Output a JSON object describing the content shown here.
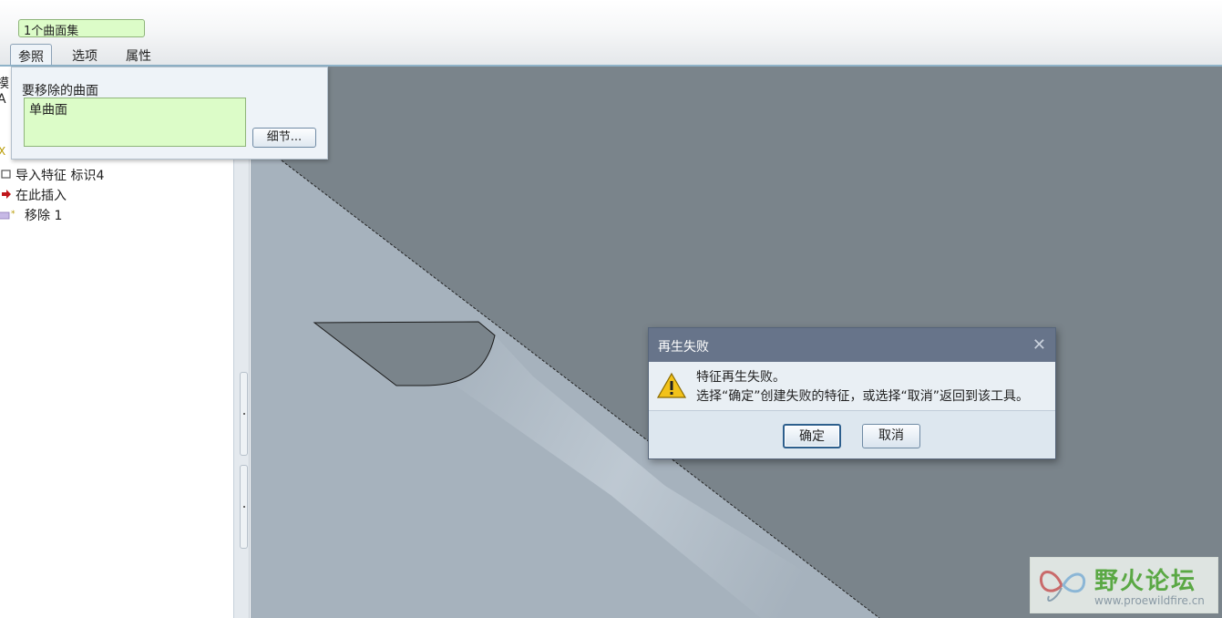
{
  "dashboard": {
    "collector_value": "1个曲面集",
    "tabs": [
      {
        "label": "参照",
        "active": true
      },
      {
        "label": "选项",
        "active": false
      },
      {
        "label": "属性",
        "active": false
      }
    ]
  },
  "ref_panel": {
    "label": "要移除的曲面",
    "selection": "单曲面",
    "detail_button": "细节..."
  },
  "model_tree": {
    "partial_items": [
      "模",
      "A",
      "X"
    ],
    "items": [
      {
        "label": "导入特征 标识4",
        "icon": "import-feature-icon"
      },
      {
        "label": "在此插入",
        "icon": "insert-here-arrow-icon"
      },
      {
        "label": "移除 1",
        "icon": "remove-feature-icon"
      }
    ]
  },
  "dialog": {
    "title": "再生失败",
    "message_line1": "特征再生失败。",
    "message_line2": "选择“确定”创建失败的特征，或选择“取消”返回到该工具。",
    "ok_label": "确定",
    "cancel_label": "取消",
    "icon": "warning-icon"
  },
  "watermark": {
    "title": "野火论坛",
    "url": "www.proewildfire.cn"
  },
  "colors": {
    "collector_bg": "#dcfcc8",
    "graphics_bg": "#7a848b",
    "dialog_title_bg": "#67748a",
    "watermark_green": "#5aa844"
  }
}
